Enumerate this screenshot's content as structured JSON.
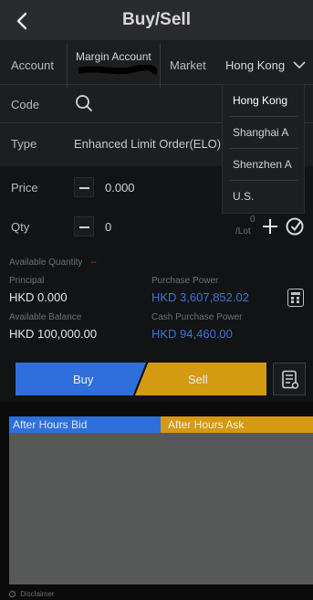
{
  "header": {
    "title": "Buy/Sell"
  },
  "account": {
    "label": "Account",
    "value": "Margin Account"
  },
  "market": {
    "label": "Market",
    "selected": "Hong Kong",
    "options": [
      "Hong Kong",
      "Shanghai A",
      "Shenzhen A",
      "U.S."
    ]
  },
  "code": {
    "label": "Code"
  },
  "type": {
    "label": "Type",
    "value": "Enhanced Limit Order(ELO)"
  },
  "price": {
    "label": "Price",
    "value": "0.000"
  },
  "qty": {
    "label": "Qty",
    "value": "0",
    "lot_value": "0",
    "lot_unit": "/Lot"
  },
  "available_quantity": {
    "label": "Available Quantity",
    "value": "--"
  },
  "principal": {
    "label": "Principal",
    "value": "HKD 0.000"
  },
  "purchase_power": {
    "label": "Purchase Power",
    "value": "HKD 3,607,852.02"
  },
  "available_balance": {
    "label": "Available Balance",
    "value": "HKD 100,000.00"
  },
  "cash_purchase_power": {
    "label": "Cash Purchase Power",
    "value": "HKD 94,460.00"
  },
  "actions": {
    "buy": "Buy",
    "sell": "Sell"
  },
  "after_hours": {
    "bid": "After Hours Bid",
    "ask": "After Hours Ask"
  },
  "footer": {
    "disclaimer": "Disclaimer"
  },
  "colors": {
    "buy_blue": "#2f6fdb",
    "sell_orange": "#d39a12",
    "value_blue": "#3b74d9",
    "header_bg": "#2a2b2e"
  },
  "icons": [
    "back-arrow-icon",
    "chevron-down-icon",
    "search-icon",
    "lock-check-icon",
    "calculator-icon",
    "order-list-icon",
    "info-icon"
  ]
}
